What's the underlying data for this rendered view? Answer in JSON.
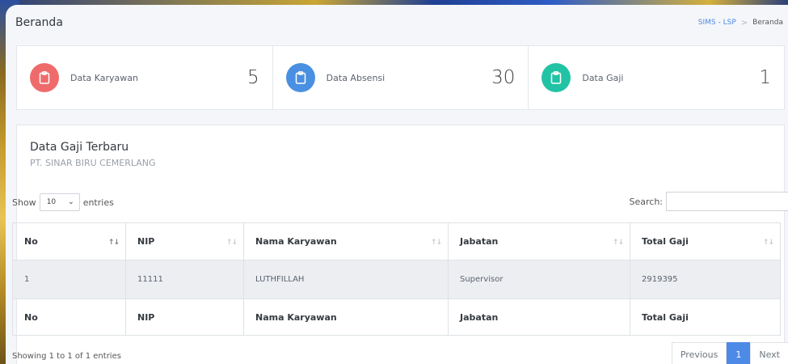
{
  "header": {
    "title": "Beranda",
    "breadcrumb": {
      "link": "SIMS - LSP",
      "separator": ">",
      "current": "Beranda"
    }
  },
  "stats": [
    {
      "label": "Data Karyawan",
      "value": "5",
      "color": "#ef6b6b",
      "icon": "clipboard-icon"
    },
    {
      "label": "Data Absensi",
      "value": "30",
      "color": "#4a90e2",
      "icon": "clipboard-icon"
    },
    {
      "label": "Data Gaji",
      "value": "1",
      "color": "#22c3a4",
      "icon": "clipboard-icon"
    }
  ],
  "card": {
    "title": "Data Gaji Terbaru",
    "subtitle": "PT. SINAR BIRU CEMERLANG"
  },
  "table_controls": {
    "show_label": "Show",
    "entries_value": "10",
    "entries_label": "entries",
    "search_label": "Search:"
  },
  "table": {
    "columns": [
      "No",
      "NIP",
      "Nama Karyawan",
      "Jabatan",
      "Total Gaji"
    ],
    "rows": [
      [
        "1",
        "11111",
        "LUTHFILLAH",
        "Supervisor",
        "2919395"
      ]
    ]
  },
  "footer": {
    "info": "Showing 1 to 1 of 1 entries",
    "previous": "Previous",
    "page": "1",
    "next": "Next"
  },
  "colors": {
    "accent": "#4d8ae6"
  }
}
